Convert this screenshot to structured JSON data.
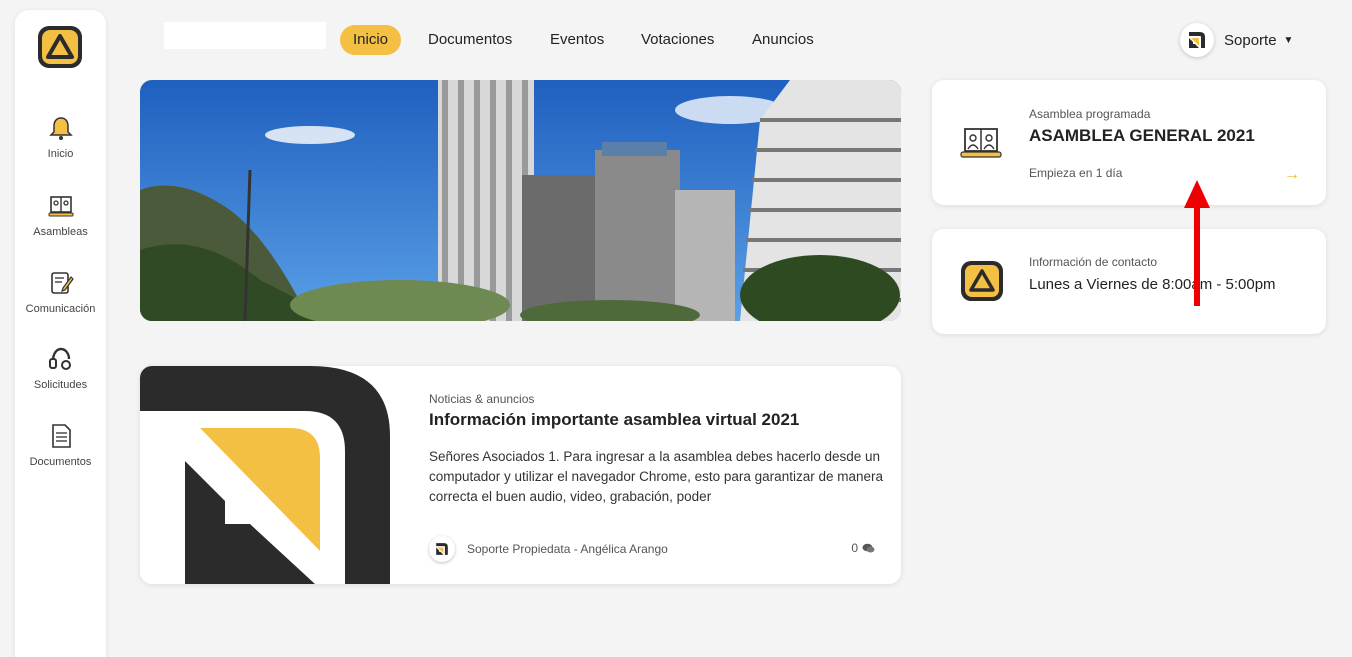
{
  "brand": {
    "accent": "#f4c043",
    "dark": "#2b2b2b",
    "annotation_color": "#ee0000"
  },
  "sidebar": {
    "items": [
      {
        "label": "Inicio",
        "icon": "bell-icon"
      },
      {
        "label": "Asambleas",
        "icon": "video-conference-icon"
      },
      {
        "label": "Comunicación",
        "icon": "edit-document-icon"
      },
      {
        "label": "Solicitudes",
        "icon": "headset-icon"
      },
      {
        "label": "Documentos",
        "icon": "document-icon"
      }
    ]
  },
  "nav": {
    "items": [
      "Inicio",
      "Documentos",
      "Eventos",
      "Votaciones",
      "Anuncios"
    ],
    "active": "Inicio"
  },
  "user": {
    "name": "Soporte"
  },
  "news": {
    "category": "Noticias & anuncios",
    "title": "Información importante asamblea virtual 2021",
    "body": "Señores Asociados  1. Para ingresar a la asamblea debes hacerlo desde un computador y utilizar el navegador Chrome, esto para garantizar de manera correcta el buen audio, video, grabación, poder",
    "author": "Soporte Propiedata - Angélica Arango",
    "comments": "0"
  },
  "assembly_card": {
    "tag": "Asamblea programada",
    "title": "ASAMBLEA GENERAL 2021",
    "starts": "Empieza en 1 día",
    "arrow": "→"
  },
  "contact_card": {
    "tag": "Información de contacto",
    "hours": "Lunes a Viernes de 8:00am - 5:00pm"
  }
}
